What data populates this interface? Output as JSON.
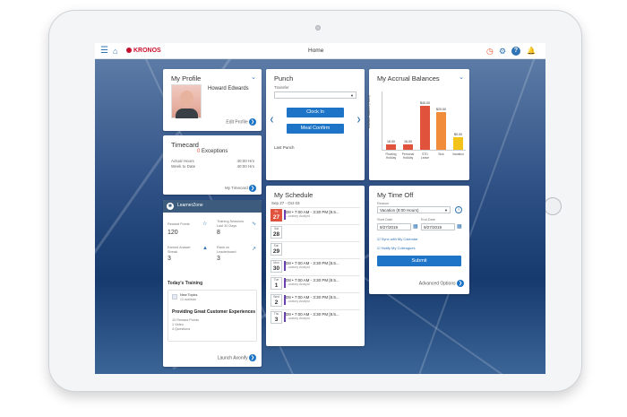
{
  "header": {
    "title": "Home",
    "logo": "KRONOS"
  },
  "profile": {
    "title": "My Profile",
    "name": "Howard Edwards",
    "edit": "Edit Profile"
  },
  "timecard": {
    "title": "Timecard",
    "exceptions_count": "0",
    "exceptions_label": "Exceptions",
    "rows": [
      {
        "label": "Actual Hours",
        "value": "40:00 Hrs"
      },
      {
        "label": "Week to Date",
        "value": "40:00 Hrs"
      }
    ],
    "link": "My Timecard"
  },
  "punch": {
    "title": "Punch",
    "transfer_label": "Transfer",
    "clock_in": "Clock In",
    "meal_confirm": "Meal Confirm",
    "last_punch": "Last Punch"
  },
  "accruals": {
    "title": "My Accrual Balances",
    "ylabel": "Available Balance (Hours)"
  },
  "chart_data": {
    "type": "bar",
    "title": "My Accrual Balances",
    "ylabel": "Available Balance (Hours)",
    "categories": [
      "Floating Holiday",
      "Personal Holiday",
      "STD Leave",
      "Sick",
      "Vacation"
    ],
    "value_labels": [
      "16.00",
      "16.00",
      "$40.00",
      "$20.00",
      "$0.00"
    ],
    "values": [
      16,
      16,
      140,
      120,
      40
    ],
    "colors": [
      "#e0523b",
      "#e0523b",
      "#e0523b",
      "#f08c3a",
      "#f2c31b"
    ]
  },
  "learner": {
    "title": "LearnerZone",
    "stats": [
      {
        "label": "Reward Points",
        "value": "120"
      },
      {
        "label": "Training Sessions Last 30 Days",
        "value": "8"
      },
      {
        "label": "Earned Answer Streak",
        "value": "3"
      },
      {
        "label": "Rank on Leaderboard",
        "value": "3"
      }
    ],
    "todays_training": "Today's Training",
    "topic_label": "New Topics",
    "topic_sub": "10 available",
    "course": "Providing Great Customer Experiences",
    "course_meta": [
      "10  Reward Points",
      "1  Video",
      "4  Questions"
    ],
    "launch": "Launch Axonify"
  },
  "schedule": {
    "title": "My Schedule",
    "range": "Sep 27 - Oct 03",
    "days": [
      {
        "dow": "Fri",
        "day": "27",
        "time": "D8 • 7:00 AM - 3:30 PM [8.5...",
        "role": "...uratory Analyst",
        "today": true,
        "has_shift": true
      },
      {
        "dow": "Sat",
        "day": "28",
        "time": "",
        "role": "",
        "today": false,
        "has_shift": false
      },
      {
        "dow": "Sun",
        "day": "29",
        "time": "",
        "role": "",
        "today": false,
        "has_shift": false
      },
      {
        "dow": "Mon",
        "day": "30",
        "time": "D8 • 7:00 AM - 3:30 PM [8.5...",
        "role": "...uratory Analyst",
        "today": false,
        "has_shift": true
      },
      {
        "dow": "Tue",
        "day": "1",
        "time": "D8 • 7:00 AM - 3:30 PM [8.5...",
        "role": "...uratory Analyst",
        "today": false,
        "has_shift": true
      },
      {
        "dow": "Wed",
        "day": "2",
        "time": "D8 • 7:00 AM - 3:30 PM [8.5...",
        "role": "...uratory Analyst",
        "today": false,
        "has_shift": true
      },
      {
        "dow": "Thu",
        "day": "3",
        "time": "D8 • 7:00 AM - 3:30 PM [8.5...",
        "role": "...uratory Analyst",
        "today": false,
        "has_shift": true
      }
    ]
  },
  "timeoff": {
    "title": "My Time Off",
    "reason_label": "Reason",
    "reason_value": "Vacation (8:00 Hours)",
    "start_label": "Start Date",
    "start_value": "9/27/2019",
    "end_label": "End Date",
    "end_value": "9/27/2019",
    "check1": "Sync with My Calendar",
    "check2": "Notify My Colleagues",
    "submit": "Submit",
    "advanced": "Advanced Options"
  }
}
